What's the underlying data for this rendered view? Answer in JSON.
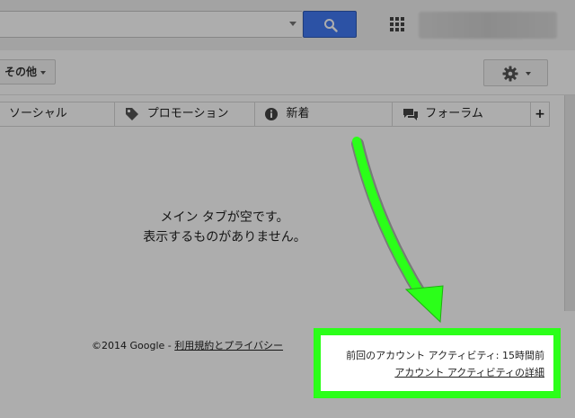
{
  "header": {
    "search": {
      "value": "",
      "placeholder": ""
    },
    "search_button_icon": "search-icon",
    "apps_icon": "apps-grid-icon"
  },
  "toolbar": {
    "more_label": "その他",
    "settings_icon": "gear-icon"
  },
  "tabs": [
    {
      "label": "ソーシャル",
      "icon": ""
    },
    {
      "label": "プロモーション",
      "icon": "tag-icon"
    },
    {
      "label": "新着",
      "icon": "info-icon"
    },
    {
      "label": "フォーラム",
      "icon": "chat-bubbles-icon"
    },
    {
      "label": "+",
      "icon": ""
    }
  ],
  "main": {
    "empty_line1": "メイン タブが空です。",
    "empty_line2": "表示するものがありません。"
  },
  "footer": {
    "copyright": "©2014 Google - ",
    "terms_link": "利用規約とプライバシー",
    "last_activity": "前回のアカウント アクティビティ: 15時間前",
    "activity_details_link": "アカウント アクティビティの詳細"
  },
  "annotation": {
    "arrow_color": "#2bff19",
    "highlight_color": "#2bff19"
  }
}
